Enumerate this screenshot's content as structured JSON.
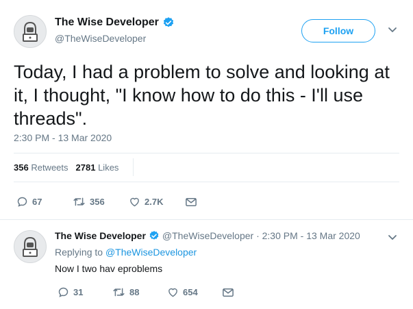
{
  "tweet": {
    "author": {
      "display_name": "The Wise Developer",
      "handle": "@TheWiseDeveloper",
      "verified": true,
      "avatar_icon": "hacker-avatar-icon"
    },
    "follow_label": "Follow",
    "text": "Today, I had a problem to solve and looking at it, I thought, \"I know how to do this - I'll use threads\".",
    "timestamp": "2:30 PM - 13 Mar 2020",
    "stats": {
      "retweets_count": "356",
      "retweets_label": "Retweets",
      "likes_count": "2781",
      "likes_label": "Likes"
    },
    "actions": {
      "replies": "67",
      "retweets": "356",
      "likes": "2.7K"
    }
  },
  "reply": {
    "author": {
      "display_name": "The Wise Developer",
      "meta": "@TheWiseDeveloper · 2:30 PM - 13 Mar 2020",
      "verified": true
    },
    "replying_prefix": "Replying to",
    "replying_to": "@TheWiseDeveloper",
    "text": "Now I two hav eproblems",
    "actions": {
      "replies": "31",
      "retweets": "88",
      "likes": "654"
    }
  },
  "colors": {
    "accent": "#1da1f2",
    "link": "#1b95e0",
    "muted": "#657786",
    "text": "#14171a",
    "divider": "#e6ecf0"
  }
}
